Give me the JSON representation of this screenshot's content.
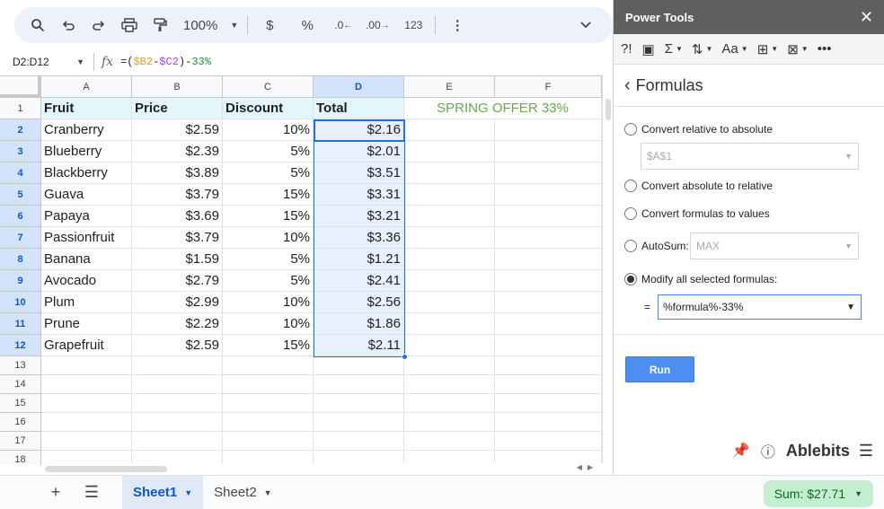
{
  "toolbar": {
    "search_icon": "search-icon",
    "zoom": "100%",
    "currency": "$",
    "percent": "%",
    "dec_decrease": ".0",
    "dec_increase": ".00",
    "number_format": "123"
  },
  "formula_bar": {
    "name_box": "D2:D12",
    "formula_prefix": "=(",
    "ref_b2": "$B2",
    "minus": "-",
    "ref_c2": "$C2",
    "formula_mid": ")-",
    "formula_pct": "33%"
  },
  "grid": {
    "columns": [
      "A",
      "B",
      "C",
      "D",
      "E",
      "F"
    ],
    "rows": [
      {
        "num": "1",
        "a": "Fruit",
        "b": "Price",
        "c": "Discount",
        "d": "Total",
        "e": "SPRING OFFER 33%"
      },
      {
        "num": "2",
        "a": "Cranberry",
        "b": "$2.59",
        "c": "10%",
        "d": "$2.16"
      },
      {
        "num": "3",
        "a": "Blueberry",
        "b": "$2.39",
        "c": "5%",
        "d": "$2.01"
      },
      {
        "num": "4",
        "a": "Blackberry",
        "b": "$3.89",
        "c": "5%",
        "d": "$3.51"
      },
      {
        "num": "5",
        "a": "Guava",
        "b": "$3.79",
        "c": "15%",
        "d": "$3.31"
      },
      {
        "num": "6",
        "a": "Papaya",
        "b": "$3.69",
        "c": "15%",
        "d": "$3.21"
      },
      {
        "num": "7",
        "a": "Passionfruit",
        "b": "$3.79",
        "c": "10%",
        "d": "$3.36"
      },
      {
        "num": "8",
        "a": "Banana",
        "b": "$1.59",
        "c": "5%",
        "d": "$1.21"
      },
      {
        "num": "9",
        "a": "Avocado",
        "b": "$2.79",
        "c": "5%",
        "d": "$2.41"
      },
      {
        "num": "10",
        "a": "Plum",
        "b": "$2.99",
        "c": "10%",
        "d": "$2.56"
      },
      {
        "num": "11",
        "a": "Prune",
        "b": "$2.29",
        "c": "10%",
        "d": "$1.86"
      },
      {
        "num": "12",
        "a": "Grapefruit",
        "b": "$2.59",
        "c": "15%",
        "d": "$2.11"
      },
      {
        "num": "13"
      },
      {
        "num": "14"
      },
      {
        "num": "15"
      },
      {
        "num": "16"
      },
      {
        "num": "17"
      },
      {
        "num": "18"
      }
    ]
  },
  "tabs": {
    "sheets": [
      "Sheet1",
      "Sheet2"
    ],
    "sum": "Sum: $27.71"
  },
  "panel": {
    "title": "Power Tools",
    "section": "Formulas",
    "options": {
      "rel_to_abs": "Convert relative to absolute",
      "rel_to_abs_value": "$A$1",
      "abs_to_rel": "Convert absolute to relative",
      "to_values": "Convert formulas to values",
      "autosum": "AutoSum:",
      "autosum_value": "MAX",
      "modify": "Modify all selected formulas:",
      "equals": "=",
      "modify_value": "%formula%-33%"
    },
    "run_label": "Run",
    "brand": "Ablebits",
    "colors": {
      "accent": "#4d8ef0",
      "title_bar": "#5f5f5f",
      "offer_text": "#6aa84f"
    }
  }
}
